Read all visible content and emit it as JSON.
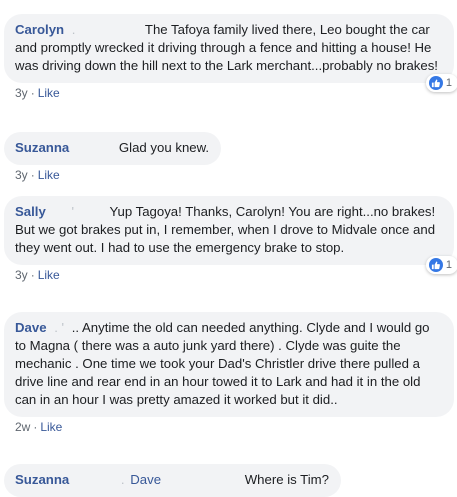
{
  "comments": [
    {
      "author": "Carolyn",
      "redacted_prefix": ".",
      "text": "The Tafoya family lived there, Leo bought the car and promptly wrecked it driving through a fence and hitting a house! He was driving down the hill next to the Lark merchant...probably no brakes!",
      "time": "3y",
      "like_label": "Like",
      "reaction_count": "1"
    },
    {
      "author": "Suzanna",
      "redacted_prefix": "",
      "text": "Glad you knew.",
      "time": "3y",
      "like_label": "Like"
    },
    {
      "author": "Sally",
      "redacted_prefix": "'",
      "text": "Yup Tagoya! Thanks, Carolyn! You are right...no brakes! But we got brakes put in, I remember, when I drove to Midvale once and they went out. I had to use the emergency brake to stop.",
      "time": "3y",
      "like_label": "Like",
      "reaction_count": "1"
    },
    {
      "author": "Dave",
      "redacted_prefix": ". '",
      "text": ".. Anytime the old can needed anything. Clyde and I would go to Magna ( there was a auto junk yard there) . Clyde was guite the mechanic . One time we took your Dad's Christler drive there pulled a drive line and rear end in an hour towed it to Lark and had it in the old can in an hour I was pretty amazed it worked but it did..",
      "time": "2w",
      "like_label": "Like"
    },
    {
      "author": "Suzanna",
      "redacted_prefix": ".",
      "mention": "Dave",
      "text": "Where is Tim?"
    }
  ],
  "separator": "·",
  "colors": {
    "link": "#385898",
    "bubble": "#f2f3f5",
    "like_badge": "#3578e5"
  }
}
